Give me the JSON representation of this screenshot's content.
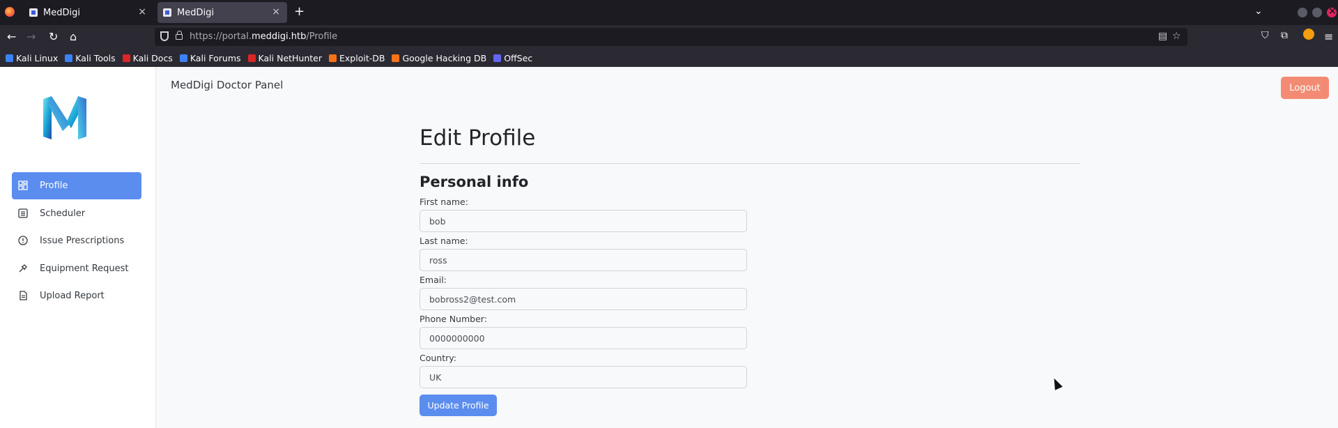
{
  "browser": {
    "tabs": [
      {
        "title": "MedDigi",
        "active": false
      },
      {
        "title": "MedDigi",
        "active": true
      }
    ],
    "new_tab": "+",
    "tab_close": "×",
    "url": {
      "scheme": "https://portal.",
      "host": "meddigi.htb",
      "path": "/Profile"
    },
    "bookmarks": [
      {
        "label": "Kali Linux",
        "color": "#3b82f6"
      },
      {
        "label": "Kali Tools",
        "color": "#3b82f6"
      },
      {
        "label": "Kali Docs",
        "color": "#dc2626"
      },
      {
        "label": "Kali Forums",
        "color": "#3b82f6"
      },
      {
        "label": "Kali NetHunter",
        "color": "#dc2626"
      },
      {
        "label": "Exploit-DB",
        "color": "#f97316"
      },
      {
        "label": "Google Hacking DB",
        "color": "#f97316"
      },
      {
        "label": "OffSec",
        "color": "#6366f1"
      }
    ]
  },
  "sidebar": {
    "items": [
      {
        "label": "Profile",
        "icon": "dashboard-icon",
        "active": true
      },
      {
        "label": "Scheduler",
        "icon": "list-icon",
        "active": false
      },
      {
        "label": "Issue Prescriptions",
        "icon": "alert-circle-icon",
        "active": false
      },
      {
        "label": "Equipment Request",
        "icon": "tools-icon",
        "active": false
      },
      {
        "label": "Upload Report",
        "icon": "document-icon",
        "active": false
      }
    ]
  },
  "header": {
    "title": "MedDigi Doctor Panel",
    "logout_label": "Logout"
  },
  "main": {
    "page_title": "Edit Profile",
    "section_title": "Personal info",
    "fields": [
      {
        "label": "First name:",
        "value": "bob"
      },
      {
        "label": "Last name:",
        "value": "ross"
      },
      {
        "label": "Email:",
        "value": "bobross2@test.com"
      },
      {
        "label": "Phone Number:",
        "value": "0000000000"
      },
      {
        "label": "Country:",
        "value": "UK"
      }
    ],
    "submit_label": "Update Profile"
  },
  "colors": {
    "accent": "#5b8def",
    "logout": "#f38b74"
  }
}
